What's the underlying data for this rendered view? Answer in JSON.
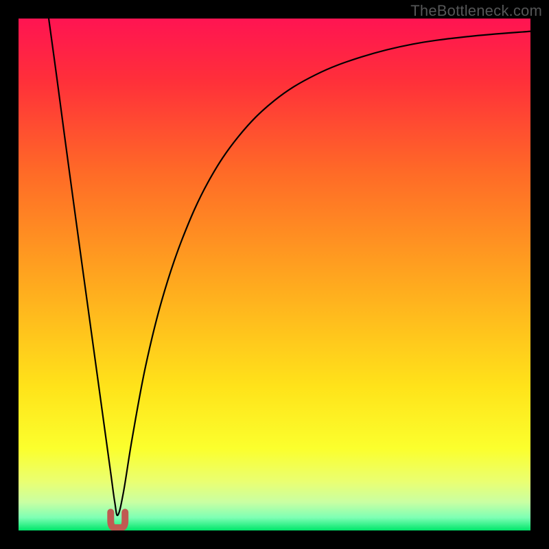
{
  "watermark": "TheBottleneck.com",
  "chart_data": {
    "type": "line",
    "title": "",
    "xlabel": "",
    "ylabel": "",
    "xlim": [
      0,
      1
    ],
    "ylim": [
      0,
      1
    ],
    "notch_x": 0.194,
    "gradient_stops": [
      {
        "pos": 0.0,
        "color": "#ff1452"
      },
      {
        "pos": 0.12,
        "color": "#ff2f3a"
      },
      {
        "pos": 0.3,
        "color": "#ff6a27"
      },
      {
        "pos": 0.5,
        "color": "#ffa41f"
      },
      {
        "pos": 0.72,
        "color": "#ffe31a"
      },
      {
        "pos": 0.84,
        "color": "#fbff2d"
      },
      {
        "pos": 0.905,
        "color": "#eaff72"
      },
      {
        "pos": 0.945,
        "color": "#c9ffa3"
      },
      {
        "pos": 0.975,
        "color": "#7dffb4"
      },
      {
        "pos": 1.0,
        "color": "#00e66a"
      }
    ],
    "series": [
      {
        "name": "left-branch",
        "points": [
          {
            "x": 0.059,
            "y": 1.0
          },
          {
            "x": 0.075,
            "y": 0.883
          },
          {
            "x": 0.09,
            "y": 0.77
          },
          {
            "x": 0.105,
            "y": 0.659
          },
          {
            "x": 0.12,
            "y": 0.549
          },
          {
            "x": 0.135,
            "y": 0.44
          },
          {
            "x": 0.15,
            "y": 0.331
          },
          {
            "x": 0.165,
            "y": 0.222
          },
          {
            "x": 0.18,
            "y": 0.113
          },
          {
            "x": 0.188,
            "y": 0.055
          },
          {
            "x": 0.194,
            "y": 0.03
          }
        ]
      },
      {
        "name": "right-branch",
        "points": [
          {
            "x": 0.194,
            "y": 0.03
          },
          {
            "x": 0.205,
            "y": 0.075
          },
          {
            "x": 0.222,
            "y": 0.18
          },
          {
            "x": 0.248,
            "y": 0.32
          },
          {
            "x": 0.28,
            "y": 0.45
          },
          {
            "x": 0.32,
            "y": 0.57
          },
          {
            "x": 0.37,
            "y": 0.68
          },
          {
            "x": 0.43,
            "y": 0.77
          },
          {
            "x": 0.5,
            "y": 0.84
          },
          {
            "x": 0.58,
            "y": 0.89
          },
          {
            "x": 0.67,
            "y": 0.925
          },
          {
            "x": 0.77,
            "y": 0.95
          },
          {
            "x": 0.88,
            "y": 0.965
          },
          {
            "x": 1.0,
            "y": 0.975
          }
        ]
      }
    ],
    "notch_marker": {
      "color": "#c05a52",
      "width_frac": 0.028,
      "height_frac": 0.033
    }
  }
}
